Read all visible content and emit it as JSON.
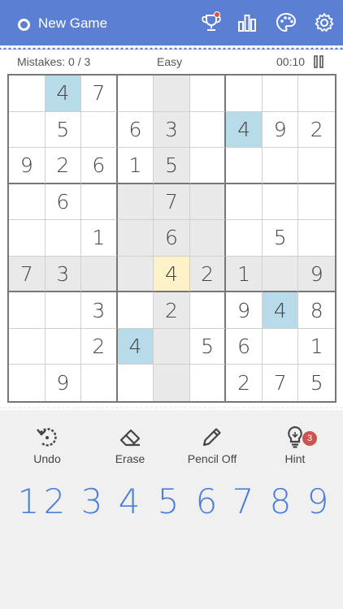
{
  "header": {
    "new_game_label": "New Game",
    "icons": [
      "trophy-icon",
      "stats-icon",
      "palette-icon",
      "gear-icon"
    ],
    "accent_color": "#5b7fd3"
  },
  "status": {
    "mistakes": "Mistakes: 0 / 3",
    "difficulty": "Easy",
    "timer": "00:10"
  },
  "board": {
    "rows": [
      [
        "",
        "4",
        "7",
        "",
        "",
        "",
        "",
        "",
        ""
      ],
      [
        "",
        "5",
        "",
        "6",
        "3",
        "",
        "4",
        "9",
        "2"
      ],
      [
        "9",
        "2",
        "6",
        "1",
        "5",
        "",
        "",
        "",
        ""
      ],
      [
        "",
        "6",
        "",
        "",
        "7",
        "",
        "",
        "",
        ""
      ],
      [
        "",
        "",
        "1",
        "",
        "6",
        "",
        "",
        "5",
        ""
      ],
      [
        "7",
        "3",
        "",
        "",
        "4",
        "2",
        "1",
        "",
        "9"
      ],
      [
        "",
        "",
        "3",
        "",
        "2",
        "",
        "9",
        "4",
        "8"
      ],
      [
        "",
        "",
        "2",
        "4",
        "",
        "5",
        "6",
        "",
        "1"
      ],
      [
        "",
        "9",
        "",
        "",
        "",
        "",
        "2",
        "7",
        "5"
      ]
    ],
    "selected": [
      5,
      4
    ],
    "highlight_same_value": "4"
  },
  "tools": {
    "undo": "Undo",
    "erase": "Erase",
    "pencil": "Pencil Off",
    "hint": "Hint",
    "hint_count": "3"
  },
  "numpad": [
    "1",
    "2",
    "3",
    "4",
    "5",
    "6",
    "7",
    "8",
    "9"
  ]
}
